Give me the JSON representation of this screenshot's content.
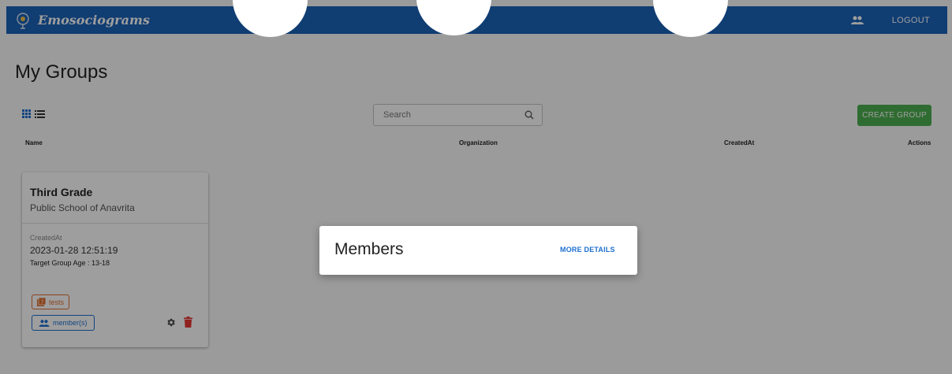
{
  "appbar": {
    "brand": "Emosociograms",
    "logout_label": "LOGOUT",
    "groups_icon": "groups-icon",
    "color": "#1b63b8"
  },
  "page": {
    "title": "My Groups"
  },
  "toolbar": {
    "view_toggle": [
      {
        "icon": "grid-view-icon",
        "active": true
      },
      {
        "icon": "list-view-icon",
        "active": false
      }
    ],
    "search": {
      "placeholder": "Search",
      "value": ""
    },
    "create_label": "CREATE GROUP",
    "create_color": "#4caf50"
  },
  "table": {
    "columns": [
      "Name",
      "Organization",
      "CreatedAt",
      "Actions"
    ]
  },
  "card": {
    "title": "Third Grade",
    "organization": "Public School of Anavrita",
    "created_label": "CreatedAt",
    "created_value": "2023-01-28 12:51:19",
    "target_age": "Target Group Age : 13-18",
    "tests_label": "tests",
    "members_label": "member(s)"
  },
  "dialog": {
    "title": "Members",
    "link_label": "MORE DETAILS"
  }
}
